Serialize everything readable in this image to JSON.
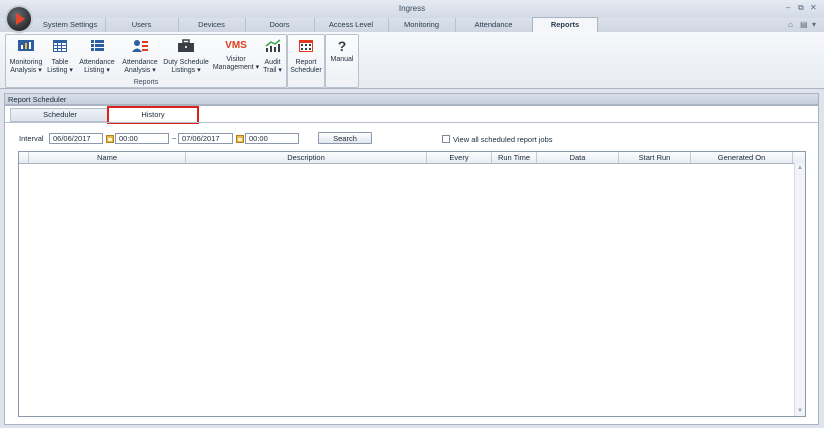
{
  "window": {
    "title": "Ingress",
    "controls": [
      "–",
      "⧉",
      "✕"
    ],
    "ribbon_controls": [
      "⌂",
      "▤",
      "▾"
    ]
  },
  "ribbon_tabs": [
    "System Settings",
    "Users",
    "Devices",
    "Doors",
    "Access Level",
    "Monitoring",
    "Attendance",
    "Reports"
  ],
  "active_tab": "Reports",
  "ribbon": {
    "group_reports_label": "Reports",
    "buttons": [
      {
        "line1": "Monitoring",
        "line2": "Analysis ▾",
        "icon": "monitor-chart-icon"
      },
      {
        "line1": "Table",
        "line2": "Listing ▾",
        "icon": "table-icon"
      },
      {
        "line1": "Attendance",
        "line2": "Listing ▾",
        "icon": "list-icon"
      },
      {
        "line1": "Attendance",
        "line2": "Analysis ▾",
        "icon": "user-list-icon"
      },
      {
        "line1": "Duty Schedule",
        "line2": "Listings ▾",
        "icon": "briefcase-icon"
      },
      {
        "line1": "Visitor",
        "line2": "Management ▾",
        "icon": "vms-icon",
        "icon_text": "VMS"
      },
      {
        "line1": "Audit",
        "line2": "Trail ▾",
        "icon": "trend-chart-icon"
      },
      {
        "line1": "Report",
        "line2": "Scheduler",
        "icon": "calendar-grid-icon"
      },
      {
        "line1": "Manual",
        "line2": "",
        "icon": "help-icon",
        "icon_text": "?"
      }
    ]
  },
  "panel": {
    "title": "Report Scheduler",
    "subtabs": [
      "Scheduler",
      "History"
    ],
    "active_subtab": "History",
    "interval_label": "Interval",
    "from_date": "06/06/2017",
    "from_time": "00:00",
    "range_sep": "~",
    "to_date": "07/06/2017",
    "to_time": "00:00",
    "search_label": "Search",
    "view_all_label": "View all scheduled report jobs",
    "view_all_checked": false,
    "columns": [
      "Name",
      "Description",
      "Every",
      "Run Time",
      "Data",
      "Start Run",
      "Generated On"
    ]
  },
  "colors": {
    "accent_red": "#d9221c",
    "vms_red": "#e0391f"
  }
}
